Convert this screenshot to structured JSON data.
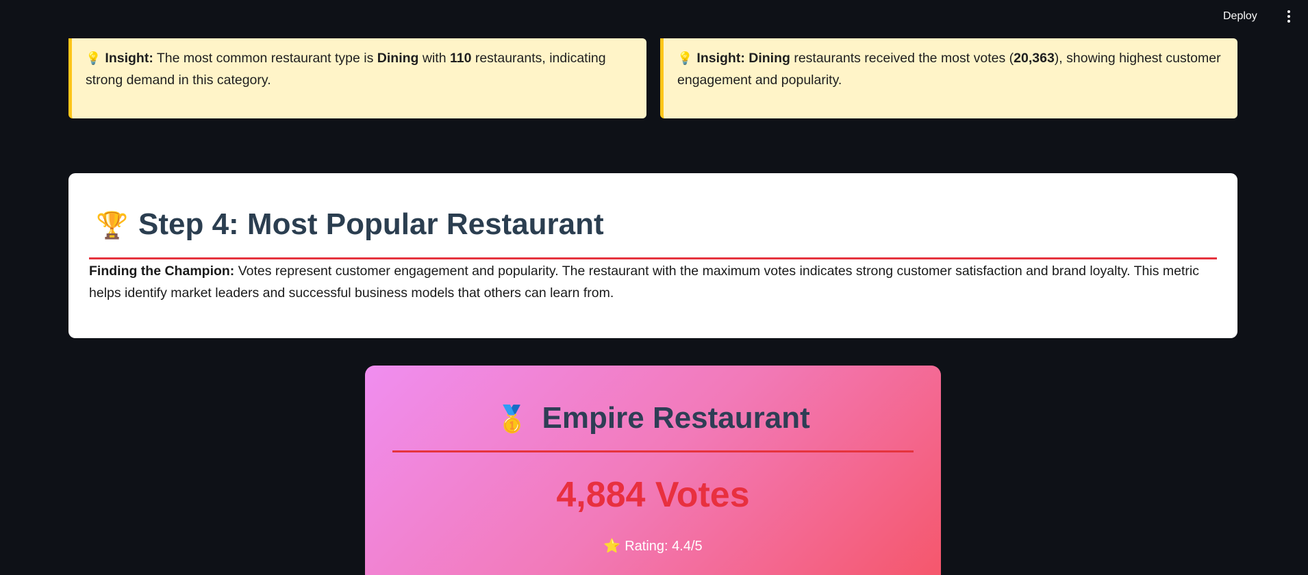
{
  "header": {
    "deploy_label": "Deploy",
    "menu_icon": "more-vertical-icon"
  },
  "insights": [
    {
      "icon": "lightbulb-icon",
      "glyph": "💡",
      "prefix": "Insight:",
      "t1": " The most common restaurant type is ",
      "b1": "Dining",
      "t2": " with ",
      "b2": "110",
      "t3": " restaurants, indicating strong demand in this category."
    },
    {
      "icon": "lightbulb-icon",
      "glyph": "💡",
      "prefix": "Insight:",
      "b1": "Dining",
      "t1": " restaurants received the most votes (",
      "b2": "20,363",
      "t2": "), showing highest customer engagement and popularity."
    }
  ],
  "step": {
    "icon": "trophy-icon",
    "glyph": "🏆",
    "title": "Step 4: Most Popular Restaurant",
    "desc_bold": "Finding the Champion:",
    "desc_text": " Votes represent customer engagement and popularity. The restaurant with the maximum votes indicates strong customer satisfaction and brand loyalty. This metric helps identify market leaders and successful business models that others can learn from."
  },
  "champion": {
    "icon": "medal-icon",
    "glyph": "🥇",
    "name": "Empire Restaurant",
    "votes": "4,884 Votes",
    "rating_icon": "star-icon",
    "star_glyph": "⭐",
    "rating": "Rating: 4.4/5"
  },
  "colors": {
    "background": "#0e1117",
    "insight_bg": "#fff4c8",
    "insight_border": "#ffc61a",
    "accent_red": "#e5343e",
    "title_color": "#2b3e50",
    "gradient_start": "#f08ef0",
    "gradient_end": "#f5576c"
  }
}
